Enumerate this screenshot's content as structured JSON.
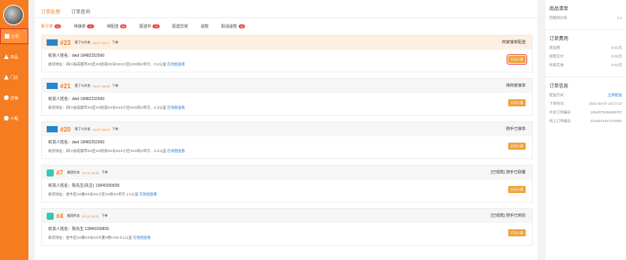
{
  "nav": {
    "items": [
      {
        "label": "订单",
        "icon": "doc-icon"
      },
      {
        "label": "商品",
        "icon": "triangle-icon"
      },
      {
        "label": "门店",
        "icon": "triangle-icon"
      },
      {
        "label": "店铺",
        "icon": "circle-icon"
      },
      {
        "label": "小程",
        "icon": "circle-icon"
      }
    ]
  },
  "top_tabs": [
    {
      "label": "订单处理"
    },
    {
      "label": "订单查询"
    }
  ],
  "status_tabs": [
    {
      "label": "新订单",
      "badge": "41"
    },
    {
      "label": "待接单",
      "badge": "47"
    },
    {
      "label": "待配送",
      "badge": "58"
    },
    {
      "label": "配送中",
      "badge": "20"
    },
    {
      "label": "配送异常",
      "badge": ""
    },
    {
      "label": "退款",
      "badge": ""
    },
    {
      "label": "取消退款",
      "badge": "30"
    }
  ],
  "orders": [
    {
      "no": "#23",
      "platform": "饿了么外卖",
      "time": "04-07 16:17",
      "meal": "下单",
      "status": "商家接单配送",
      "receiver": "收货人姓名：dwd  18482252560",
      "address": "收货地址：四川省成都市XX区XX街道XX号XXX小区XXX栋X单元... 0.2公里",
      "map_link": "在地图查看",
      "button": "打印小票",
      "highlight": true
    },
    {
      "no": "#21",
      "platform": "饿了么外卖",
      "time": "04-07 16:05",
      "meal": "下单",
      "status": "待商家接单",
      "receiver": "收货人姓名：dwd  18482232560",
      "address": "收货地址：四川省成都市XX区XX街道XX号XXX小区XXX栋X单元... 0.2公里",
      "map_link": "在地图查看",
      "button": "打印小票",
      "highlight": false
    },
    {
      "no": "#20",
      "platform": "饿了么外卖",
      "time": "04-07 16:02",
      "meal": "下单",
      "status": "骑手已接单",
      "receiver": "收货人姓名：dwd  18482252560",
      "address": "收货地址：四川省成都市XX区XX街道XX号XXX小区XXX栋X单元... 0.2公里",
      "map_link": "在地图查看",
      "button": "打印小票",
      "highlight": false
    },
    {
      "no": "#7",
      "platform": "美团外卖",
      "time": "03-31 18:05",
      "meal": "下单",
      "status": "[已收款] 骑手已取餐",
      "receiver": "收货人姓名：陈先生(先生)  13840299835",
      "address": "收货地址：金牛区XX路XX号XX小区XX栋XX单元  1.1公里",
      "map_link": "在地图查看",
      "button": "打印小票",
      "highlight": false
    },
    {
      "no": "#4",
      "platform": "美团外卖",
      "time": "03-30 15:31",
      "meal": "下单",
      "status": "[已收款] 骑手已到店",
      "receiver": "收货人姓名：陈先生  13840299835",
      "address": "收货地址：金牛区XX路XX号XX大厦X楼1704  0.1公里",
      "map_link": "在地图查看",
      "button": "打印小票",
      "highlight": false
    }
  ],
  "right": {
    "goods_title": "商品清单",
    "goods": [
      {
        "name": "回锅肉炒饭",
        "qty": "x 1"
      }
    ],
    "fee_title": "订单费用",
    "fees": [
      {
        "label": "商品费",
        "value": "0.01元"
      },
      {
        "label": "顾客实付",
        "value": "0.01元"
      },
      {
        "label": "商家实收",
        "value": "0.01元"
      }
    ],
    "info_title": "订单信息",
    "info": [
      {
        "label": "配送方式",
        "value": "立即配送",
        "link": true
      },
      {
        "label": "下单时间",
        "value": "2021-04-07 16:17:17",
        "link": false
      },
      {
        "label": "外卖订单编号",
        "value": "1064073248459757",
        "link": false
      },
      {
        "label": "线上订单编号",
        "value": "2104071617170001",
        "link": false
      }
    ]
  }
}
